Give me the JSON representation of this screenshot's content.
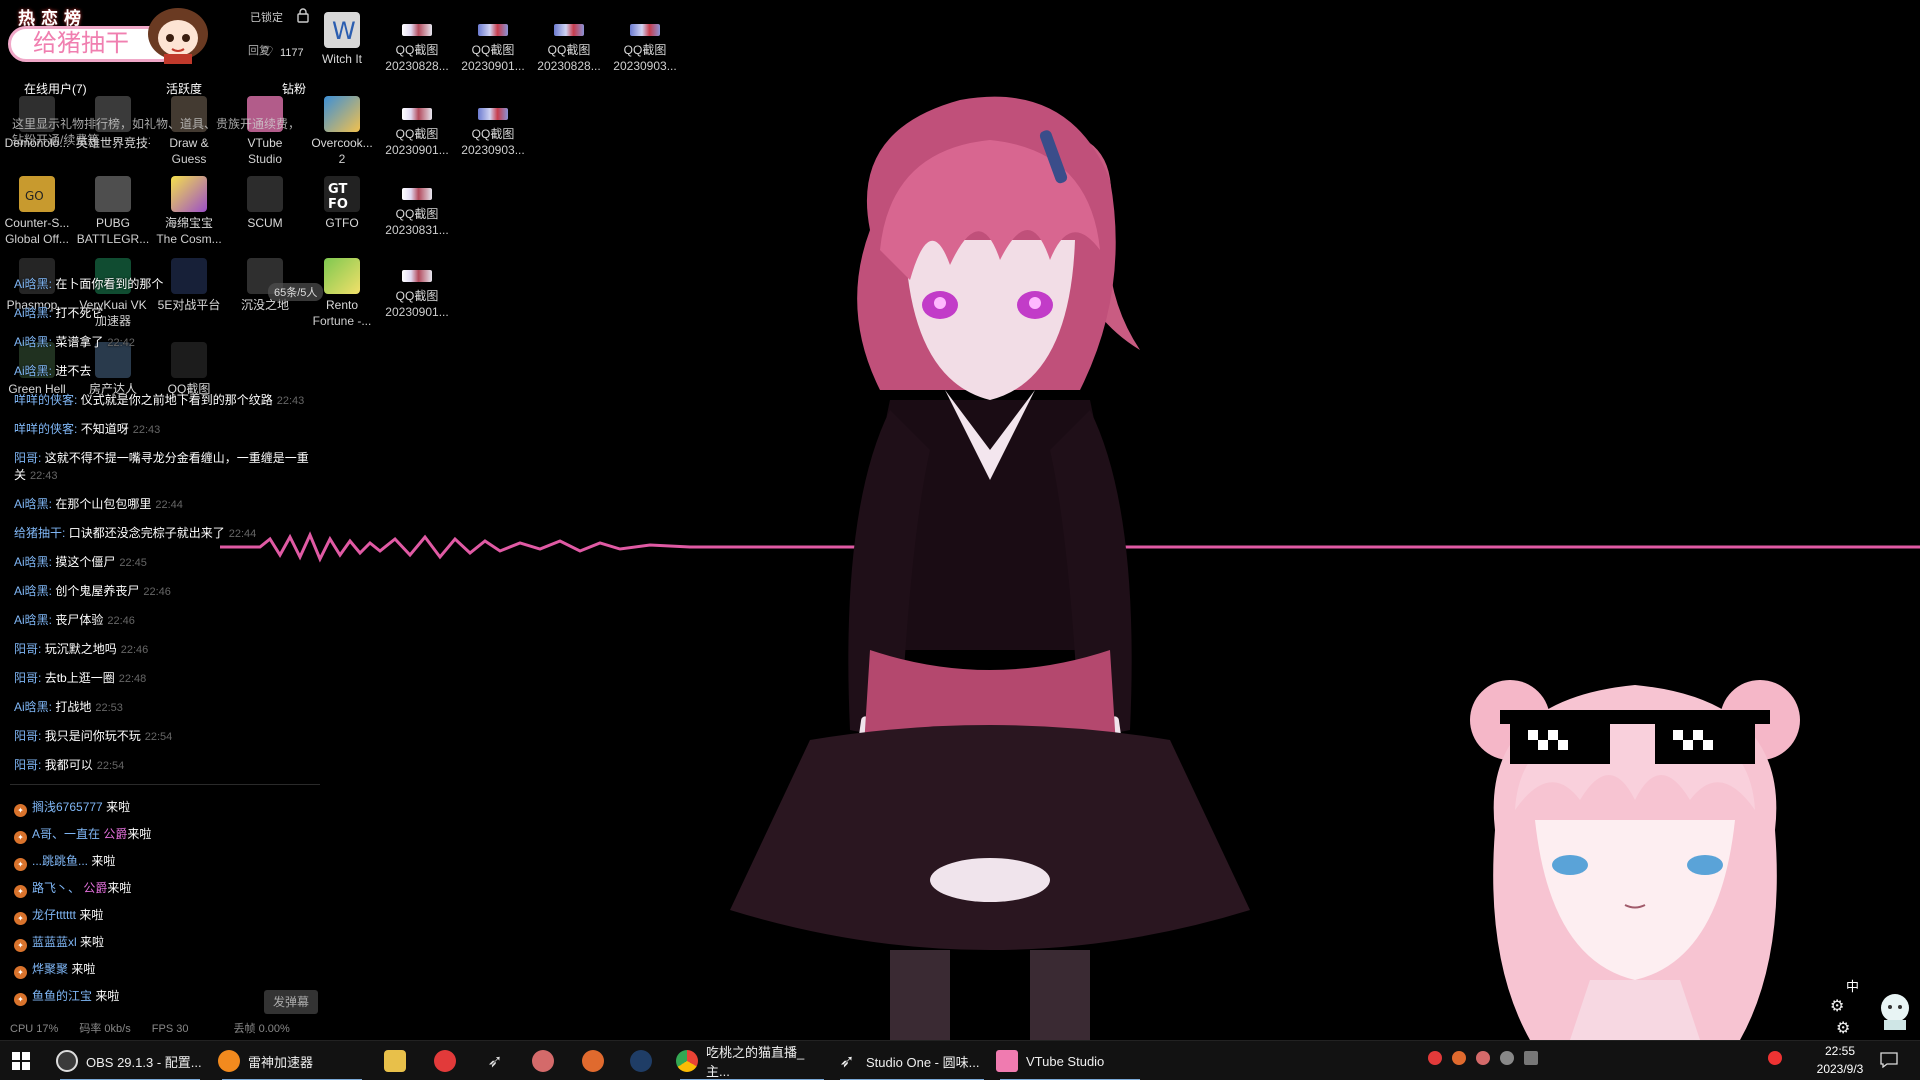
{
  "overlay": {
    "banner_title": "热恋榜",
    "banner_sub": "给猪抽干",
    "locked_label": "已锁定",
    "return_label": "回复",
    "like_count": "1177",
    "online_users": "在线用户(7)",
    "activity": "活跃度",
    "fans": "钻粉",
    "gift_hint": "这里显示礼物排行榜，如礼物、道具、贵族开通续费，钻粉开通/续费等",
    "msg_count": "65条/5人",
    "send_button": "发弹幕",
    "stats": {
      "cpu": "CPU 17%",
      "bitrate": "码率 0kb/s",
      "fps": "FPS 30",
      "drop": "丢帧 0.00%"
    }
  },
  "desktop_icons": [
    {
      "name": "Witch It",
      "l2": ""
    },
    {
      "name": "QQ截图",
      "l2": "20230828..."
    },
    {
      "name": "QQ截图",
      "l2": "20230901..."
    },
    {
      "name": "QQ截图",
      "l2": "20230828..."
    },
    {
      "name": "QQ截图",
      "l2": "20230903..."
    },
    {
      "name": "Demonolo...",
      "l2": ""
    },
    {
      "name": "英雄世界竞技平台",
      "l2": ""
    },
    {
      "name": "Draw &",
      "l2": "Guess"
    },
    {
      "name": "VTube",
      "l2": "Studio"
    },
    {
      "name": "Overcook...",
      "l2": "2"
    },
    {
      "name": "QQ截图",
      "l2": "20230901..."
    },
    {
      "name": "QQ截图",
      "l2": "20230903..."
    },
    {
      "name": "Counter-S...",
      "l2": "Global Off..."
    },
    {
      "name": "PUBG",
      "l2": "BATTLEGR..."
    },
    {
      "name": "海绵宝宝",
      "l2": "The Cosm..."
    },
    {
      "name": "SCUM",
      "l2": ""
    },
    {
      "name": "GTFO",
      "l2": ""
    },
    {
      "name": "QQ截图",
      "l2": "20230831..."
    },
    {
      "name": "Phasmop...",
      "l2": ""
    },
    {
      "name": "VeryKuai VK",
      "l2": "加速器"
    },
    {
      "name": "5E对战平台",
      "l2": ""
    },
    {
      "name": "沉没之地",
      "l2": ""
    },
    {
      "name": "Rento",
      "l2": "Fortune -..."
    },
    {
      "name": "QQ截图",
      "l2": "20230901..."
    },
    {
      "name": "Green Hell",
      "l2": ""
    },
    {
      "name": "房产达人",
      "l2": ""
    },
    {
      "name": "QQ截图",
      "l2": ""
    }
  ],
  "chat": [
    {
      "user": "Ai晗黑:",
      "text": "在卜面你看到的那个",
      "time": ""
    },
    {
      "user": "Ai晗黑:",
      "text": "打不死它",
      "time": ""
    },
    {
      "user": "Ai晗黑:",
      "text": "菜谱拿了",
      "time": "22:42"
    },
    {
      "user": "Ai晗黑:",
      "text": "进不去",
      "time": ""
    },
    {
      "user": "咩咩的侠客:",
      "text": "仪式就是你之前地下看到的那个纹路",
      "time": "22:43"
    },
    {
      "user": "咩咩的侠客:",
      "text": "不知道呀",
      "time": "22:43"
    },
    {
      "user": "阳哥:",
      "text": "这就不得不提一嘴寻龙分金看缠山，一重缠是一重关",
      "time": "22:43"
    },
    {
      "user": "Ai晗黑:",
      "text": "在那个山包包哪里",
      "time": "22:44"
    },
    {
      "user": "给猪抽干:",
      "text": "口诀都还没念完棕子就出来了",
      "time": "22:44"
    },
    {
      "user": "Ai晗黑:",
      "text": "摸这个僵尸",
      "time": "22:45"
    },
    {
      "user": "Ai晗黑:",
      "text": "创个鬼屋养丧尸",
      "time": "22:46"
    },
    {
      "user": "Ai晗黑:",
      "text": "丧尸体验",
      "time": "22:46"
    },
    {
      "user": "阳哥:",
      "text": "玩沉默之地吗",
      "time": "22:46"
    },
    {
      "user": "阳哥:",
      "text": "去tb上逛一圈",
      "time": "22:48"
    },
    {
      "user": "Ai晗黑:",
      "text": "打战地",
      "time": "22:53"
    },
    {
      "user": "阳哥:",
      "text": "我只是问你玩不玩",
      "time": "22:54"
    },
    {
      "user": "阳哥:",
      "text": "我都可以",
      "time": "22:54"
    }
  ],
  "entries": [
    {
      "name": "搁浅6765777",
      "badge": "",
      "suffix": "来啦"
    },
    {
      "name": "A哥、一直在",
      "badge": "公爵",
      "suffix": "来啦"
    },
    {
      "name": "...跳跳鱼...",
      "badge": "",
      "suffix": "来啦"
    },
    {
      "name": "路飞丶、",
      "badge": "公爵",
      "suffix": "来啦"
    },
    {
      "name": "龙仔tttttt",
      "badge": "",
      "suffix": "来啦"
    },
    {
      "name": "蓝蓝蓝xl",
      "badge": "",
      "suffix": "来啦"
    },
    {
      "name": "烨聚聚",
      "badge": "",
      "suffix": "来啦"
    },
    {
      "name": "鱼鱼的江宝",
      "badge": "",
      "suffix": "来啦"
    }
  ],
  "taskbar": {
    "items": [
      {
        "label": "OBS 29.1.3 - 配置...",
        "color": "#3a3a3a"
      },
      {
        "label": "雷神加速器",
        "color": "#f28a1e"
      },
      {
        "label": "吃桃之的猫直播_主...",
        "color": "#4285f4"
      },
      {
        "label": "Studio One - 圆味...",
        "color": "#e9e9e9"
      },
      {
        "label": "VTube Studio",
        "color": "#f07bb0"
      }
    ],
    "ime": "中",
    "time": "22:55",
    "date": "2023/9/3"
  },
  "colors": {
    "accent": "#e05aa4",
    "chat_user": "#7fb6f5"
  }
}
